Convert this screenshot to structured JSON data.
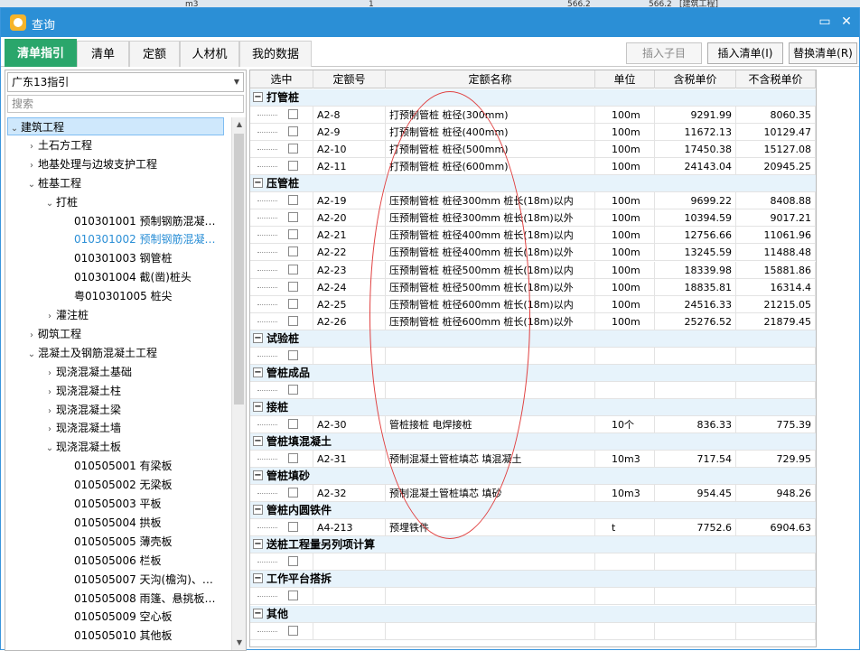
{
  "window": {
    "title": "查询"
  },
  "background": {
    "cell1": "m3",
    "cell2": "1",
    "cell3": "566.2",
    "cell4": "566.2",
    "cell5": "[建筑工程]"
  },
  "tabs": [
    "清单指引",
    "清单",
    "定额",
    "人材机",
    "我的数据"
  ],
  "toolbar": {
    "insert_child": "插入子目",
    "insert_list": "插入清单(I)",
    "replace_list": "替换清单(R)"
  },
  "left": {
    "combo": "广东13指引",
    "search_placeholder": "搜索",
    "tree": [
      {
        "label": "建筑工程",
        "tog": "⌄"
      },
      {
        "label": "土石方工程",
        "tog": "›"
      },
      {
        "label": "地基处理与边坡支护工程",
        "tog": "›"
      },
      {
        "label": "桩基工程",
        "tog": "⌄"
      },
      {
        "label": "打桩",
        "tog": "⌄"
      },
      {
        "label": "010301001  预制钢筋混凝…",
        "tog": ""
      },
      {
        "label": "010301002  预制钢筋混凝…",
        "tog": ""
      },
      {
        "label": "010301003  钢管桩",
        "tog": ""
      },
      {
        "label": "010301004  截(凿)桩头",
        "tog": ""
      },
      {
        "label": "粤010301005  桩尖",
        "tog": ""
      },
      {
        "label": "灌注桩",
        "tog": "›"
      },
      {
        "label": "砌筑工程",
        "tog": "›"
      },
      {
        "label": "混凝土及钢筋混凝土工程",
        "tog": "⌄"
      },
      {
        "label": "现浇混凝土基础",
        "tog": "›"
      },
      {
        "label": "现浇混凝土柱",
        "tog": "›"
      },
      {
        "label": "现浇混凝土梁",
        "tog": "›"
      },
      {
        "label": "现浇混凝土墙",
        "tog": "›"
      },
      {
        "label": "现浇混凝土板",
        "tog": "⌄"
      },
      {
        "label": "010505001  有梁板",
        "tog": ""
      },
      {
        "label": "010505002  无梁板",
        "tog": ""
      },
      {
        "label": "010505003  平板",
        "tog": ""
      },
      {
        "label": "010505004  拱板",
        "tog": ""
      },
      {
        "label": "010505005  薄壳板",
        "tog": ""
      },
      {
        "label": "010505006  栏板",
        "tog": ""
      },
      {
        "label": "010505007  天沟(檐沟)、…",
        "tog": ""
      },
      {
        "label": "010505008  雨篷、悬挑板…",
        "tog": ""
      },
      {
        "label": "010505009  空心板",
        "tog": ""
      },
      {
        "label": "010505010  其他板",
        "tog": ""
      }
    ]
  },
  "grid": {
    "headers": [
      "选中",
      "定额号",
      "定额名称",
      "单位",
      "含税单价",
      "不含税单价"
    ],
    "rows": [
      {
        "type": "group",
        "name": "打管桩"
      },
      {
        "type": "item",
        "code": "A2-8",
        "name": "打预制管桩 桩径(300mm)",
        "unit": "100m",
        "tax": "9291.99",
        "notax": "8060.35"
      },
      {
        "type": "item",
        "code": "A2-9",
        "name": "打预制管桩 桩径(400mm)",
        "unit": "100m",
        "tax": "11672.13",
        "notax": "10129.47"
      },
      {
        "type": "item",
        "code": "A2-10",
        "name": "打预制管桩 桩径(500mm)",
        "unit": "100m",
        "tax": "17450.38",
        "notax": "15127.08"
      },
      {
        "type": "item",
        "code": "A2-11",
        "name": "打预制管桩 桩径(600mm)",
        "unit": "100m",
        "tax": "24143.04",
        "notax": "20945.25"
      },
      {
        "type": "group",
        "name": "压管桩"
      },
      {
        "type": "item",
        "code": "A2-19",
        "name": "压预制管桩 桩径300mm 桩长(18m)以内",
        "unit": "100m",
        "tax": "9699.22",
        "notax": "8408.88"
      },
      {
        "type": "item",
        "code": "A2-20",
        "name": "压预制管桩 桩径300mm 桩长(18m)以外",
        "unit": "100m",
        "tax": "10394.59",
        "notax": "9017.21"
      },
      {
        "type": "item",
        "code": "A2-21",
        "name": "压预制管桩 桩径400mm 桩长(18m)以内",
        "unit": "100m",
        "tax": "12756.66",
        "notax": "11061.96"
      },
      {
        "type": "item",
        "code": "A2-22",
        "name": "压预制管桩 桩径400mm 桩长(18m)以外",
        "unit": "100m",
        "tax": "13245.59",
        "notax": "11488.48"
      },
      {
        "type": "item",
        "code": "A2-23",
        "name": "压预制管桩 桩径500mm 桩长(18m)以内",
        "unit": "100m",
        "tax": "18339.98",
        "notax": "15881.86"
      },
      {
        "type": "item",
        "code": "A2-24",
        "name": "压预制管桩 桩径500mm 桩长(18m)以外",
        "unit": "100m",
        "tax": "18835.81",
        "notax": "16314.4"
      },
      {
        "type": "item",
        "code": "A2-25",
        "name": "压预制管桩 桩径600mm 桩长(18m)以内",
        "unit": "100m",
        "tax": "24516.33",
        "notax": "21215.05"
      },
      {
        "type": "item",
        "code": "A2-26",
        "name": "压预制管桩 桩径600mm 桩长(18m)以外",
        "unit": "100m",
        "tax": "25276.52",
        "notax": "21879.45"
      },
      {
        "type": "group",
        "name": "试验桩"
      },
      {
        "type": "item",
        "code": "",
        "name": "",
        "unit": "",
        "tax": "",
        "notax": ""
      },
      {
        "type": "group",
        "name": "管桩成品"
      },
      {
        "type": "item",
        "code": "",
        "name": "",
        "unit": "",
        "tax": "",
        "notax": ""
      },
      {
        "type": "group",
        "name": "接桩"
      },
      {
        "type": "item",
        "code": "A2-30",
        "name": "管桩接桩 电焊接桩",
        "unit": "10个",
        "tax": "836.33",
        "notax": "775.39"
      },
      {
        "type": "group",
        "name": "管桩填混凝土"
      },
      {
        "type": "item",
        "code": "A2-31",
        "name": "预制混凝土管桩填芯 填混凝土",
        "unit": "10m3",
        "tax": "717.54",
        "notax": "729.95"
      },
      {
        "type": "group",
        "name": "管桩填砂"
      },
      {
        "type": "item",
        "code": "A2-32",
        "name": "预制混凝土管桩填芯 填砂",
        "unit": "10m3",
        "tax": "954.45",
        "notax": "948.26"
      },
      {
        "type": "group",
        "name": "管桩内圆铁件"
      },
      {
        "type": "item",
        "code": "A4-213",
        "name": "预埋铁件",
        "unit": "t",
        "tax": "7752.6",
        "notax": "6904.63"
      },
      {
        "type": "group",
        "name": "送桩工程量另列项计算"
      },
      {
        "type": "item",
        "code": "",
        "name": "",
        "unit": "",
        "tax": "",
        "notax": ""
      },
      {
        "type": "group",
        "name": "工作平台搭拆"
      },
      {
        "type": "item",
        "code": "",
        "name": "",
        "unit": "",
        "tax": "",
        "notax": ""
      },
      {
        "type": "group",
        "name": "其他"
      },
      {
        "type": "item",
        "code": "",
        "name": "",
        "unit": "",
        "tax": "",
        "notax": ""
      }
    ]
  }
}
